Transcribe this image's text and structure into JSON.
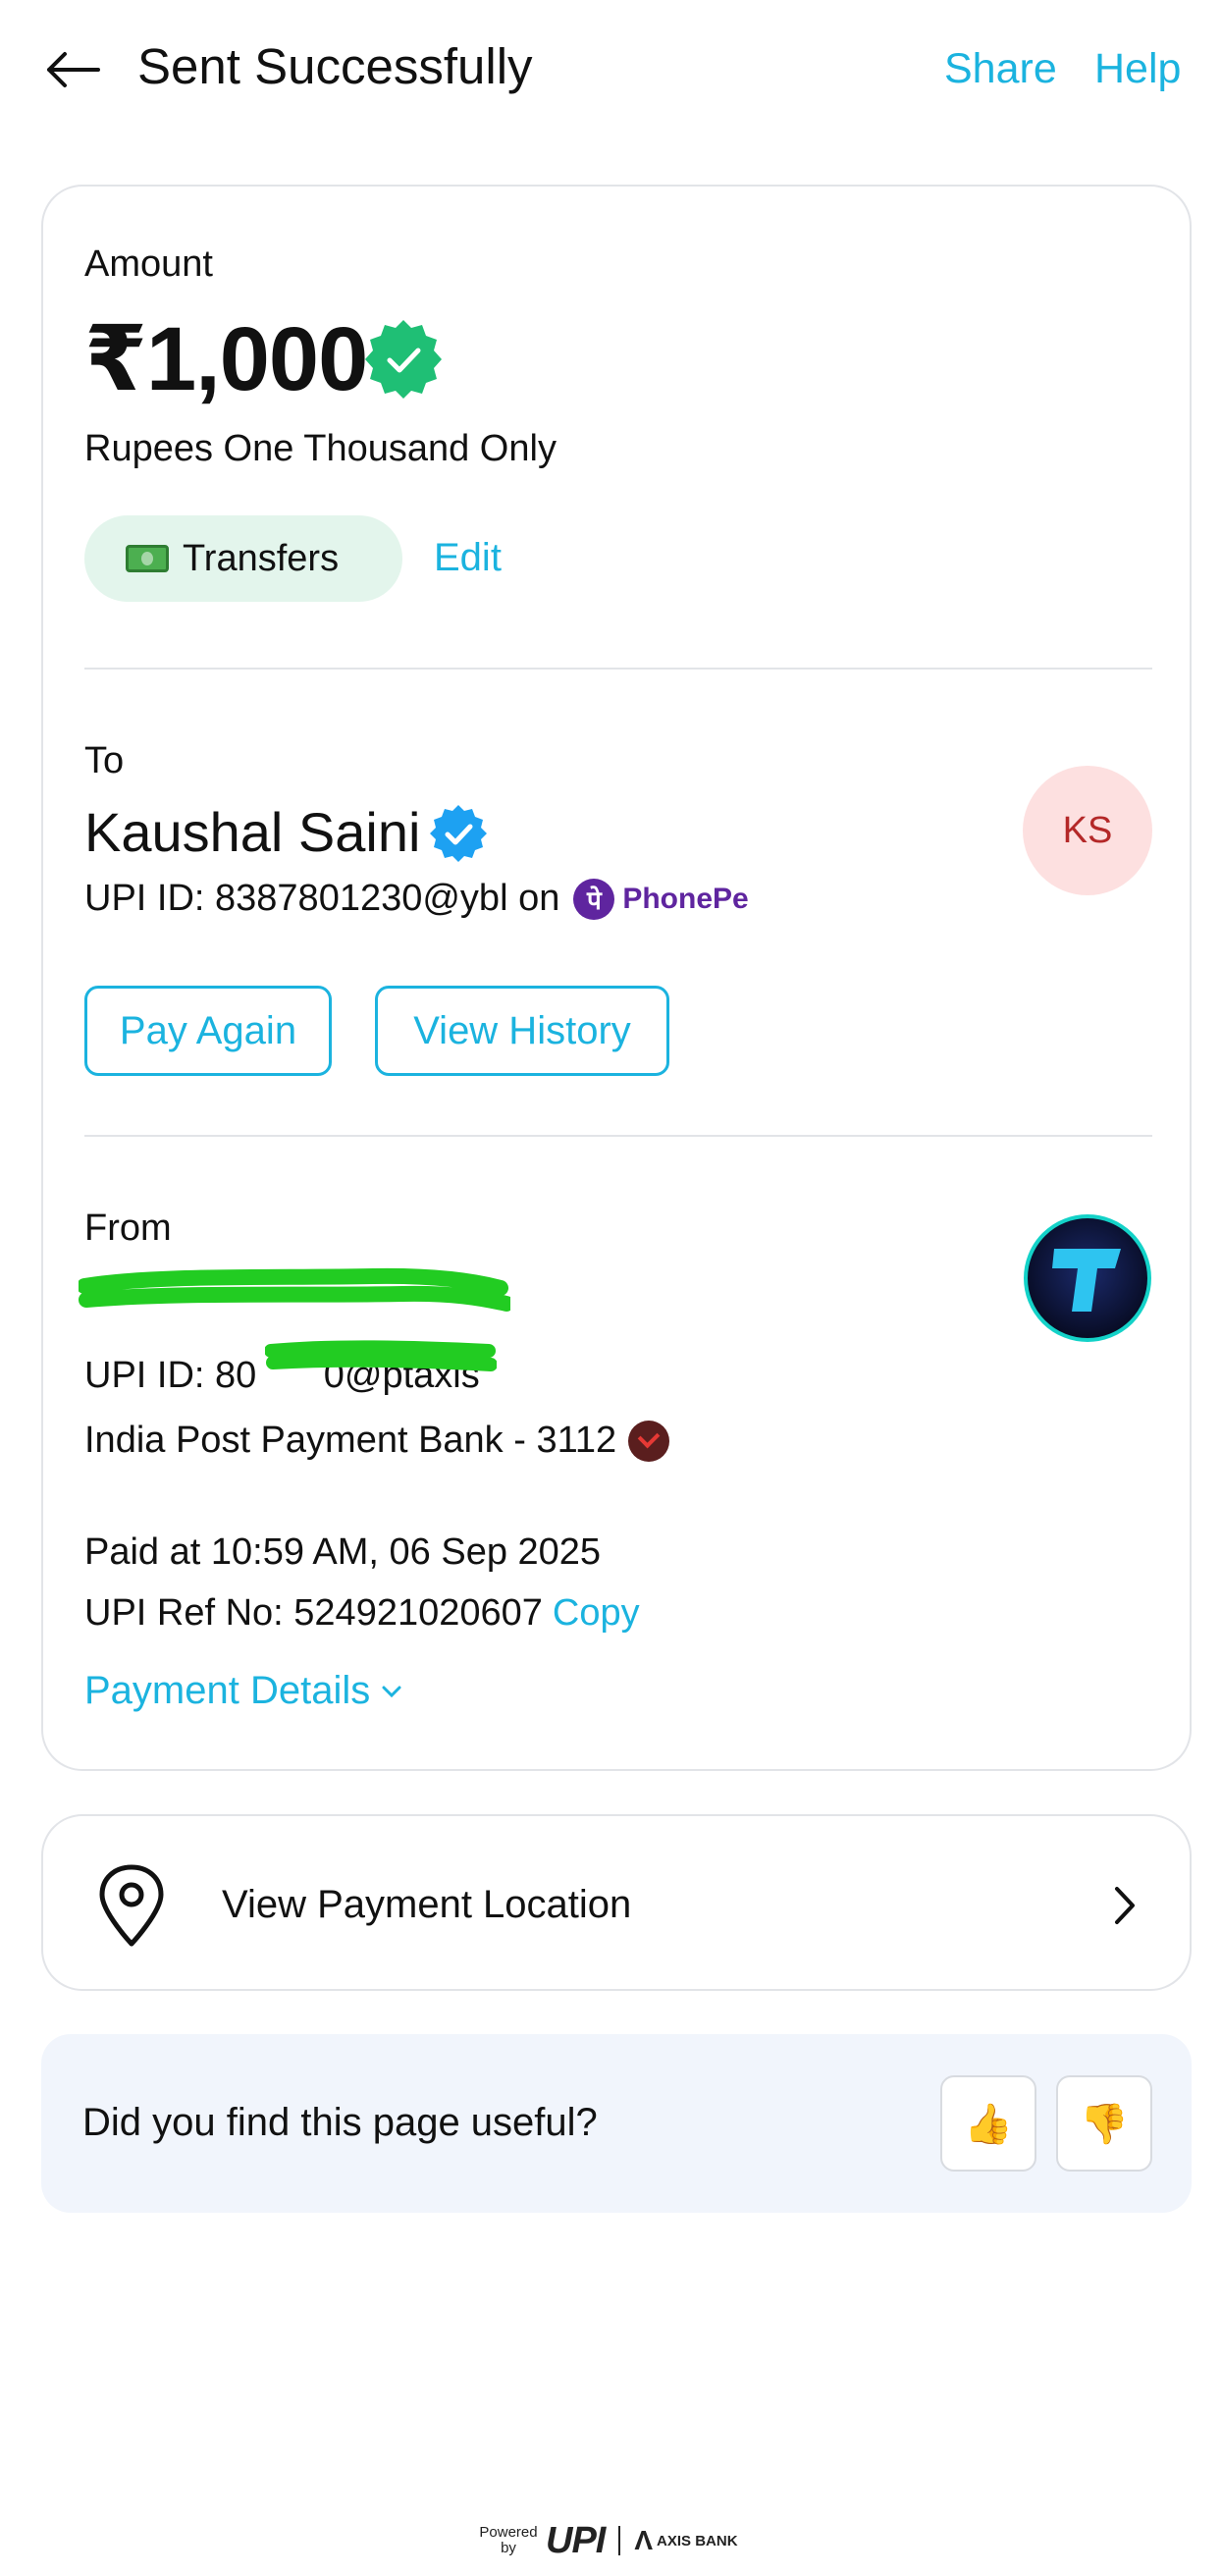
{
  "header": {
    "title": "Sent Successfully",
    "share_label": "Share",
    "help_label": "Help"
  },
  "amount_section": {
    "label": "Amount",
    "amount": "₹1,000",
    "amount_in_words": "Rupees One Thousand Only",
    "category": "Transfers",
    "edit_label": "Edit"
  },
  "to_section": {
    "label": "To",
    "name": "Kaushal Saini",
    "upi_line": "UPI ID: 8387801230@ybl on",
    "app_name": "PhonePe",
    "avatar_initials": "KS",
    "pay_again_label": "Pay Again",
    "view_history_label": "View History"
  },
  "from_section": {
    "label": "From",
    "upi_line": "UPI ID: 80         0@ptaxis",
    "bank": "India Post Payment Bank - 3112",
    "avatar_letter": "T"
  },
  "payment_info": {
    "paid_at": "Paid at 10:59 AM, 06 Sep 2025",
    "ref_no": "UPI Ref No: 524921020607",
    "copy_label": "Copy",
    "details_label": "Payment Details"
  },
  "location": {
    "label": "View Payment Location"
  },
  "feedback": {
    "question": "Did you find this page useful?",
    "thumbs_up": "👍",
    "thumbs_down": "👎"
  },
  "footer": {
    "powered_by": "Powered by",
    "upi_logo": "UPI",
    "bank_logo": "AXIS BANK"
  },
  "colors": {
    "accent": "#1bb3df",
    "success": "#1fbf75",
    "verified": "#1da1f2",
    "phonepe": "#5f259f",
    "redaction": "#22cc22"
  }
}
